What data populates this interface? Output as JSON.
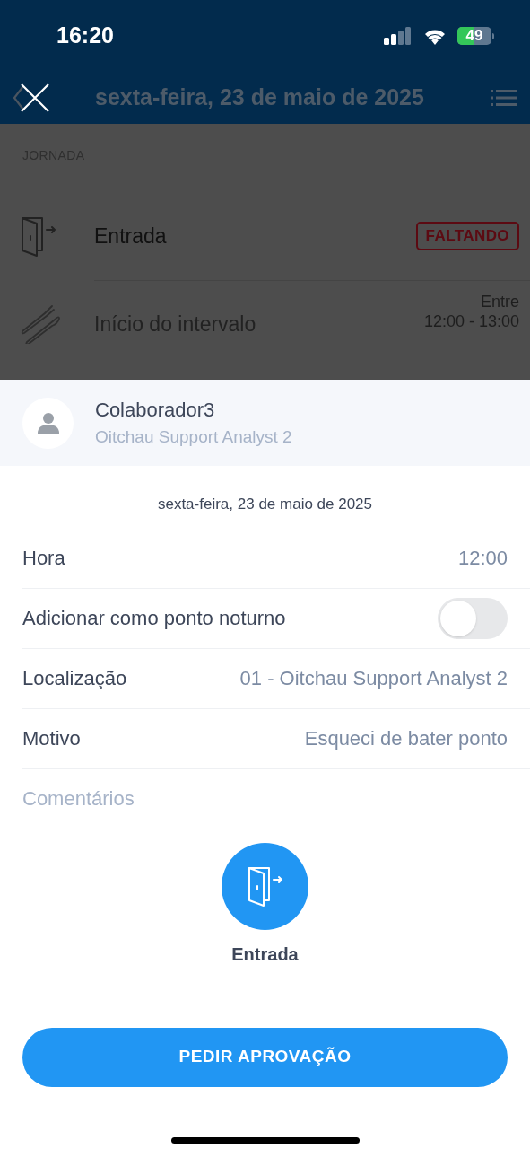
{
  "status_bar": {
    "time": "16:20",
    "battery": "49"
  },
  "header": {
    "title": "sexta-feira, 23 de maio de 2025"
  },
  "background_list": {
    "section": "JORNADA",
    "items": [
      {
        "kind": "door",
        "label": "Entrada",
        "badge": "FALTANDO"
      },
      {
        "kind": "cutlery",
        "label": "Início do intervalo",
        "note": [
          "Entre",
          "12:00 - 13:00"
        ]
      }
    ]
  },
  "user": {
    "name": "Colaborador3",
    "role": "Oitchau Support Analyst 2"
  },
  "form": {
    "date": "sexta-feira, 23 de maio de 2025",
    "rows": [
      {
        "kind": "value",
        "label": "Hora",
        "value": "12:00"
      },
      {
        "kind": "toggle",
        "label": "Adicionar como ponto noturno",
        "on": false
      },
      {
        "kind": "value",
        "label": "Localização",
        "value": "01 - Oitchau Support Analyst 2"
      },
      {
        "kind": "value",
        "label": "Motivo",
        "value": "Esqueci de bater ponto"
      }
    ],
    "comments": {
      "placeholder": "Comentários"
    }
  },
  "punch": {
    "label": "Entrada"
  },
  "submit": "PEDIR APROVAÇÃO"
}
